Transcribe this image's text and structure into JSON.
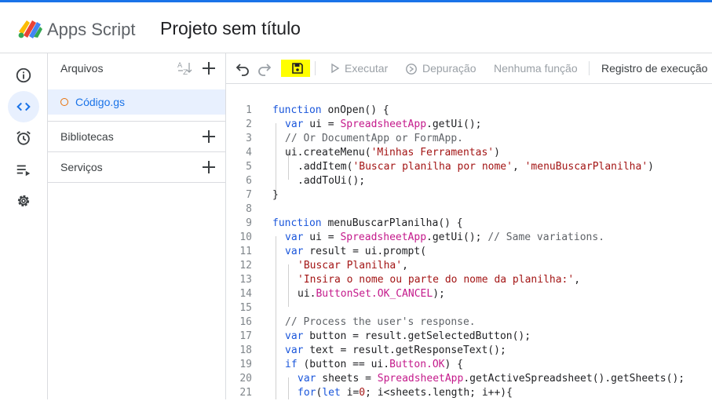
{
  "header": {
    "app_name": "Apps Script",
    "project_title": "Projeto sem título"
  },
  "left_rail": {
    "items": [
      "overview-icon",
      "code-icon",
      "triggers-icon",
      "executions-icon",
      "settings-icon"
    ],
    "active": "code-icon"
  },
  "files_panel": {
    "files_label": "Arquivos",
    "files": [
      {
        "name": "Código.gs"
      }
    ],
    "libraries_label": "Bibliotecas",
    "services_label": "Serviços"
  },
  "toolbar": {
    "run_label": "Executar",
    "debug_label": "Depuração",
    "function_select": "Nenhuma função",
    "exec_log_label": "Registro de execução"
  },
  "colors": {
    "accent": "#1a73e8",
    "highlight": "#ffff00",
    "keyword": "#1a56db",
    "string": "#a31515",
    "object": "#c41a8b"
  },
  "code": {
    "lines": [
      {
        "n": "1",
        "indent": 0,
        "tokens": [
          {
            "t": "kw",
            "v": "function"
          },
          {
            "t": "p",
            "v": " onOpen() {"
          }
        ]
      },
      {
        "n": "2",
        "indent": 1,
        "tokens": [
          {
            "t": "kw",
            "v": "var"
          },
          {
            "t": "p",
            "v": " ui = "
          },
          {
            "t": "obj",
            "v": "SpreadsheetApp"
          },
          {
            "t": "p",
            "v": ".getUi();"
          }
        ]
      },
      {
        "n": "3",
        "indent": 1,
        "tokens": [
          {
            "t": "cmt",
            "v": "// Or DocumentApp or FormApp."
          }
        ]
      },
      {
        "n": "4",
        "indent": 1,
        "tokens": [
          {
            "t": "p",
            "v": "ui.createMenu("
          },
          {
            "t": "str",
            "v": "'Minhas Ferramentas'"
          },
          {
            "t": "p",
            "v": ")"
          }
        ]
      },
      {
        "n": "5",
        "indent": 2,
        "tokens": [
          {
            "t": "p",
            "v": ".addItem("
          },
          {
            "t": "str",
            "v": "'Buscar planilha por nome'"
          },
          {
            "t": "p",
            "v": ", "
          },
          {
            "t": "str",
            "v": "'menuBuscarPlanilha'"
          },
          {
            "t": "p",
            "v": ")"
          }
        ]
      },
      {
        "n": "6",
        "indent": 2,
        "tokens": [
          {
            "t": "p",
            "v": ".addToUi();"
          }
        ]
      },
      {
        "n": "7",
        "indent": 0,
        "tokens": [
          {
            "t": "p",
            "v": "}"
          }
        ]
      },
      {
        "n": "8",
        "indent": 0,
        "tokens": []
      },
      {
        "n": "9",
        "indent": 0,
        "tokens": [
          {
            "t": "kw",
            "v": "function"
          },
          {
            "t": "p",
            "v": " menuBuscarPlanilha() {"
          }
        ]
      },
      {
        "n": "10",
        "indent": 1,
        "tokens": [
          {
            "t": "kw",
            "v": "var"
          },
          {
            "t": "p",
            "v": " ui = "
          },
          {
            "t": "obj",
            "v": "SpreadsheetApp"
          },
          {
            "t": "p",
            "v": ".getUi(); "
          },
          {
            "t": "cmt",
            "v": "// Same variations."
          }
        ]
      },
      {
        "n": "11",
        "indent": 1,
        "tokens": [
          {
            "t": "kw",
            "v": "var"
          },
          {
            "t": "p",
            "v": " result = ui.prompt("
          }
        ]
      },
      {
        "n": "12",
        "indent": 2,
        "tokens": [
          {
            "t": "str",
            "v": "'Buscar Planilha'"
          },
          {
            "t": "p",
            "v": ","
          }
        ]
      },
      {
        "n": "13",
        "indent": 2,
        "tokens": [
          {
            "t": "str",
            "v": "'Insira o nome ou parte do nome da planilha:'"
          },
          {
            "t": "p",
            "v": ","
          }
        ]
      },
      {
        "n": "14",
        "indent": 2,
        "tokens": [
          {
            "t": "p",
            "v": "ui."
          },
          {
            "t": "obj",
            "v": "ButtonSet.OK_CANCEL"
          },
          {
            "t": "p",
            "v": ");"
          }
        ]
      },
      {
        "n": "15",
        "indent": 1,
        "tokens": []
      },
      {
        "n": "16",
        "indent": 1,
        "tokens": [
          {
            "t": "cmt",
            "v": "// Process the user's response."
          }
        ]
      },
      {
        "n": "17",
        "indent": 1,
        "tokens": [
          {
            "t": "kw",
            "v": "var"
          },
          {
            "t": "p",
            "v": " button = result.getSelectedButton();"
          }
        ]
      },
      {
        "n": "18",
        "indent": 1,
        "tokens": [
          {
            "t": "kw",
            "v": "var"
          },
          {
            "t": "p",
            "v": " text = result.getResponseText();"
          }
        ]
      },
      {
        "n": "19",
        "indent": 1,
        "tokens": [
          {
            "t": "kw",
            "v": "if"
          },
          {
            "t": "p",
            "v": " (button == ui."
          },
          {
            "t": "obj",
            "v": "Button.OK"
          },
          {
            "t": "p",
            "v": ") {"
          }
        ]
      },
      {
        "n": "20",
        "indent": 2,
        "tokens": [
          {
            "t": "kw",
            "v": "var"
          },
          {
            "t": "p",
            "v": " sheets = "
          },
          {
            "t": "obj",
            "v": "SpreadsheetApp"
          },
          {
            "t": "p",
            "v": ".getActiveSpreadsheet().getSheets();"
          }
        ]
      },
      {
        "n": "21",
        "indent": 2,
        "tokens": [
          {
            "t": "kw",
            "v": "for"
          },
          {
            "t": "p",
            "v": "("
          },
          {
            "t": "kw",
            "v": "let"
          },
          {
            "t": "p",
            "v": " i="
          },
          {
            "t": "str",
            "v": "0"
          },
          {
            "t": "p",
            "v": "; i<sheets.length; i++){"
          }
        ]
      }
    ]
  }
}
